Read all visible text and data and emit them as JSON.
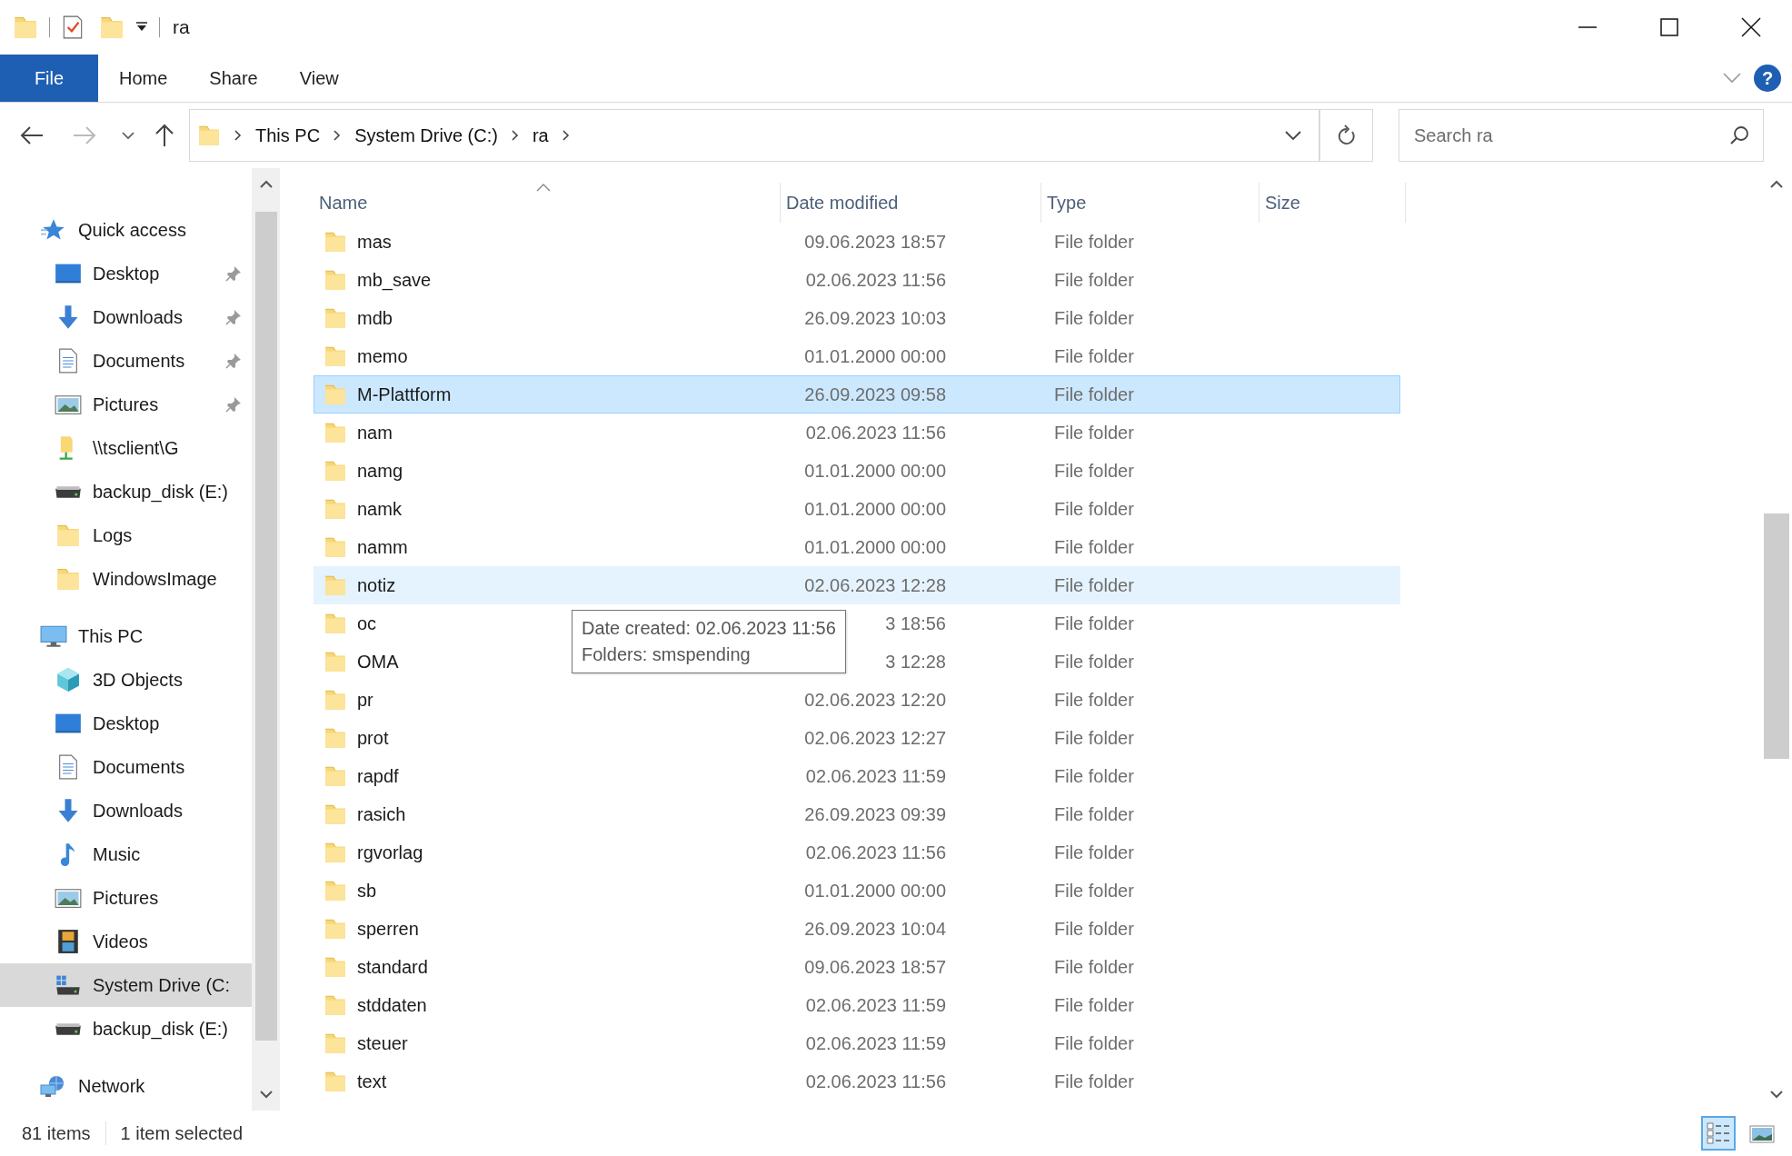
{
  "window": {
    "title": "ra"
  },
  "ribbon": {
    "tabs": [
      {
        "label": "File",
        "kind": "file"
      },
      {
        "label": "Home",
        "kind": "tab"
      },
      {
        "label": "Share",
        "kind": "tab"
      },
      {
        "label": "View",
        "kind": "tab"
      }
    ],
    "help": "?"
  },
  "address": {
    "breadcrumbs": [
      "This PC",
      "System Drive (C:)",
      "ra"
    ]
  },
  "search": {
    "placeholder": "Search ra"
  },
  "nav": [
    {
      "label": "Quick access",
      "kind": "star",
      "selected": false,
      "children": [
        {
          "label": "Desktop",
          "kind": "desktop",
          "pinned": true,
          "selected": false
        },
        {
          "label": "Downloads",
          "kind": "download",
          "pinned": true,
          "selected": false
        },
        {
          "label": "Documents",
          "kind": "document",
          "pinned": true,
          "selected": false
        },
        {
          "label": "Pictures",
          "kind": "pictures",
          "pinned": true,
          "selected": false
        },
        {
          "label": "\\\\tsclient\\G",
          "kind": "share",
          "pinned": false,
          "selected": false
        },
        {
          "label": "backup_disk (E:)",
          "kind": "drive",
          "pinned": false,
          "selected": false
        },
        {
          "label": "Logs",
          "kind": "folder",
          "pinned": false,
          "selected": false
        },
        {
          "label": "WindowsImage",
          "kind": "folder",
          "pinned": false,
          "selected": false
        }
      ]
    },
    {
      "label": "This PC",
      "kind": "pc",
      "selected": false,
      "children": [
        {
          "label": "3D Objects",
          "kind": "cube",
          "pinned": false,
          "selected": false
        },
        {
          "label": "Desktop",
          "kind": "desktop",
          "pinned": false,
          "selected": false
        },
        {
          "label": "Documents",
          "kind": "document",
          "pinned": false,
          "selected": false
        },
        {
          "label": "Downloads",
          "kind": "download",
          "pinned": false,
          "selected": false
        },
        {
          "label": "Music",
          "kind": "music",
          "pinned": false,
          "selected": false
        },
        {
          "label": "Pictures",
          "kind": "pictures",
          "pinned": false,
          "selected": false
        },
        {
          "label": "Videos",
          "kind": "video",
          "pinned": false,
          "selected": false
        },
        {
          "label": "System Drive (C:",
          "kind": "sysdrive",
          "pinned": false,
          "selected": true
        },
        {
          "label": "backup_disk (E:)",
          "kind": "drive",
          "pinned": false,
          "selected": false
        }
      ]
    },
    {
      "label": "Network",
      "kind": "network",
      "selected": false
    }
  ],
  "columns": [
    {
      "label": "Name",
      "sorted": true
    },
    {
      "label": "Date modified",
      "sorted": false
    },
    {
      "label": "Type",
      "sorted": false
    },
    {
      "label": "Size",
      "sorted": false
    }
  ],
  "rows": [
    {
      "name": "mas",
      "date": "09.06.2023 18:57",
      "type": "File folder",
      "selected": false,
      "hovered": false
    },
    {
      "name": "mb_save",
      "date": "02.06.2023 11:56",
      "type": "File folder",
      "selected": false,
      "hovered": false
    },
    {
      "name": "mdb",
      "date": "26.09.2023 10:03",
      "type": "File folder",
      "selected": false,
      "hovered": false
    },
    {
      "name": "memo",
      "date": "01.01.2000 00:00",
      "type": "File folder",
      "selected": false,
      "hovered": false
    },
    {
      "name": "M-Plattform",
      "date": "26.09.2023 09:58",
      "type": "File folder",
      "selected": true,
      "hovered": false
    },
    {
      "name": "nam",
      "date": "02.06.2023 11:56",
      "type": "File folder",
      "selected": false,
      "hovered": false
    },
    {
      "name": "namg",
      "date": "01.01.2000 00:00",
      "type": "File folder",
      "selected": false,
      "hovered": false
    },
    {
      "name": "namk",
      "date": "01.01.2000 00:00",
      "type": "File folder",
      "selected": false,
      "hovered": false
    },
    {
      "name": "namm",
      "date": "01.01.2000 00:00",
      "type": "File folder",
      "selected": false,
      "hovered": false
    },
    {
      "name": "notiz",
      "date": "02.06.2023 12:28",
      "type": "File folder",
      "selected": false,
      "hovered": true
    },
    {
      "name": "oc",
      "date": "3 18:56",
      "type": "File folder",
      "selected": false,
      "hovered": false
    },
    {
      "name": "OMA",
      "date": "3 12:28",
      "type": "File folder",
      "selected": false,
      "hovered": false
    },
    {
      "name": "pr",
      "date": "02.06.2023 12:20",
      "type": "File folder",
      "selected": false,
      "hovered": false
    },
    {
      "name": "prot",
      "date": "02.06.2023 12:27",
      "type": "File folder",
      "selected": false,
      "hovered": false
    },
    {
      "name": "rapdf",
      "date": "02.06.2023 11:59",
      "type": "File folder",
      "selected": false,
      "hovered": false
    },
    {
      "name": "rasich",
      "date": "26.09.2023 09:39",
      "type": "File folder",
      "selected": false,
      "hovered": false
    },
    {
      "name": "rgvorlag",
      "date": "02.06.2023 11:56",
      "type": "File folder",
      "selected": false,
      "hovered": false
    },
    {
      "name": "sb",
      "date": "01.01.2000 00:00",
      "type": "File folder",
      "selected": false,
      "hovered": false
    },
    {
      "name": "sperren",
      "date": "26.09.2023 10:04",
      "type": "File folder",
      "selected": false,
      "hovered": false
    },
    {
      "name": "standard",
      "date": "09.06.2023 18:57",
      "type": "File folder",
      "selected": false,
      "hovered": false
    },
    {
      "name": "stddaten",
      "date": "02.06.2023 11:59",
      "type": "File folder",
      "selected": false,
      "hovered": false
    },
    {
      "name": "steuer",
      "date": "02.06.2023 11:59",
      "type": "File folder",
      "selected": false,
      "hovered": false
    },
    {
      "name": "text",
      "date": "02.06.2023 11:56",
      "type": "File folder",
      "selected": false,
      "hovered": false
    }
  ],
  "tooltip": {
    "lines": [
      "Date created: 02.06.2023 11:56",
      "Folders: smspending"
    ]
  },
  "status": {
    "count": "81 items",
    "selection": "1 item selected"
  },
  "views": [
    {
      "kind": "details",
      "selected": true
    },
    {
      "kind": "large",
      "selected": false
    }
  ]
}
